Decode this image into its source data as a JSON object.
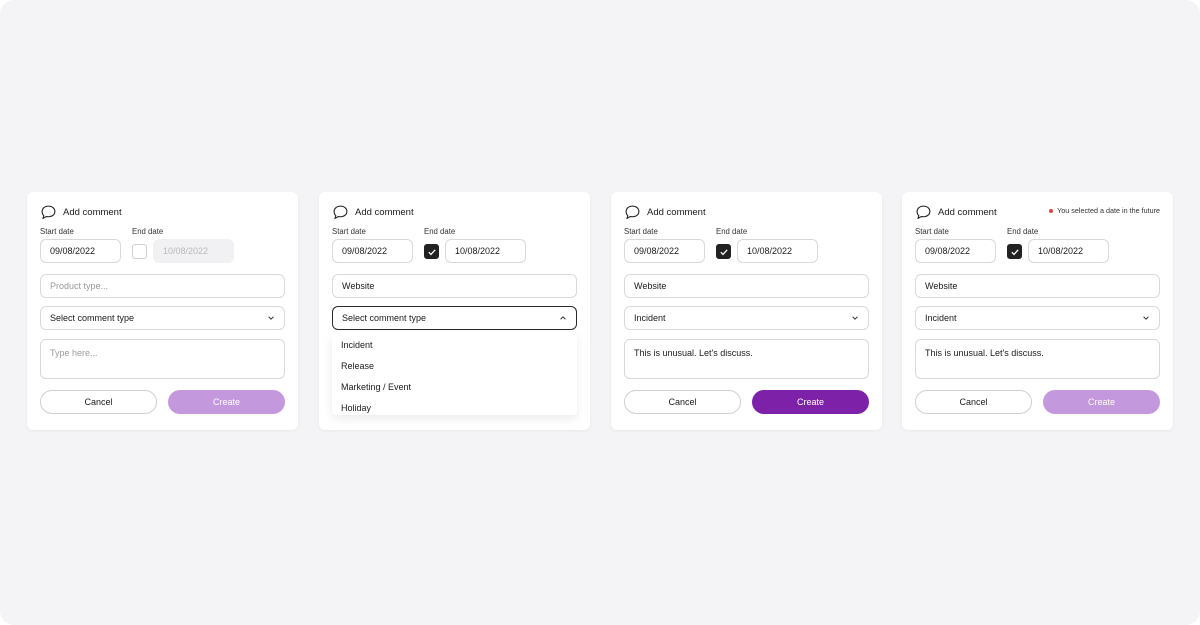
{
  "cards": [
    {
      "title": "Add comment",
      "start_label": "Start date",
      "end_label": "End date",
      "start_value": "09/08/2022",
      "end_value": "10/08/2022",
      "end_checked": false,
      "product_placeholder": "Product type...",
      "select_value": "Select comment type",
      "textarea_placeholder": "Type here...",
      "cancel": "Cancel",
      "create": "Create",
      "create_state": "disabled"
    },
    {
      "title": "Add comment",
      "start_label": "Start date",
      "end_label": "End date",
      "start_value": "09/08/2022",
      "end_value": "10/08/2022",
      "end_checked": true,
      "product_value": "Website",
      "select_value": "Select comment type",
      "dropdown_open": true,
      "options": [
        "Incident",
        "Release",
        "Marketing / Event",
        "Holiday"
      ]
    },
    {
      "title": "Add comment",
      "start_label": "Start date",
      "end_label": "End date",
      "start_value": "09/08/2022",
      "end_value": "10/08/2022",
      "end_checked": true,
      "product_value": "Website",
      "select_value": "Incident",
      "textarea_value": "This is unusual. Let's discuss.",
      "cancel": "Cancel",
      "create": "Create",
      "create_state": "active"
    },
    {
      "title": "Add comment",
      "warning": "You selected a date in the future",
      "start_label": "Start date",
      "end_label": "End date",
      "start_value": "09/08/2022",
      "end_value": "10/08/2022",
      "end_checked": true,
      "product_value": "Website",
      "select_value": "Incident",
      "textarea_value": "This is unusual. Let's discuss.",
      "cancel": "Cancel",
      "create": "Create",
      "create_state": "disabled"
    }
  ],
  "colors": {
    "background": "#f4f4f6",
    "create_active": "#7d22a8",
    "create_disabled": "#c398dc",
    "warning_dot": "#e0463a",
    "checkbox_checked": "#222222"
  },
  "icons": {
    "header": "comment-bubble-icon",
    "checkbox": "check-icon",
    "select_closed": "chevron-down-icon",
    "select_open": "chevron-up-icon"
  }
}
